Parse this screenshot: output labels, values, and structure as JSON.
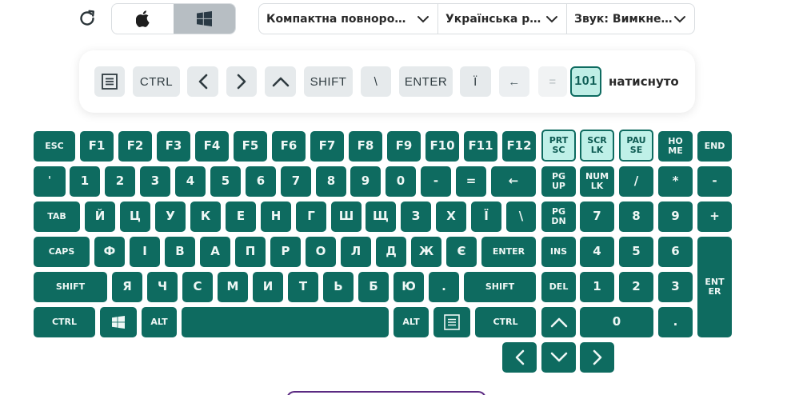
{
  "toolbar": {
    "os_options": [
      "apple-logo",
      "windows-logo"
    ],
    "os_selected": "windows",
    "dropdowns": [
      {
        "label": "Компактна повноро…"
      },
      {
        "label": "Українська р…"
      },
      {
        "label": "Звук: Вимкне…"
      }
    ]
  },
  "history": {
    "keys": [
      "menu-icon",
      "CTRL",
      "arrow-left-icon",
      "arrow-right-icon",
      "arrow-up-icon",
      "SHIFT",
      "\\",
      "ENTER",
      "Ї",
      "←",
      "=",
      "101"
    ],
    "count": "101",
    "status": "натиснуто"
  },
  "keyboard": {
    "rows": {
      "function": [
        "ESC",
        "F1",
        "F2",
        "F3",
        "F4",
        "F5",
        "F6",
        "F7",
        "F8",
        "F9",
        "F10",
        "F11",
        "F12",
        "PRT\nSC",
        "SCR\nLK",
        "PAU\nSE",
        "HO\nME",
        "END"
      ],
      "number": [
        "'",
        "1",
        "2",
        "3",
        "4",
        "5",
        "6",
        "7",
        "8",
        "9",
        "0",
        "-",
        "=",
        "←",
        "PG\nUP",
        "NUM\nLK",
        "/",
        "*",
        "-"
      ],
      "top": [
        "TAB",
        "Й",
        "Ц",
        "У",
        "К",
        "Е",
        "Н",
        "Г",
        "Ш",
        "Щ",
        "З",
        "Х",
        "Ї",
        "\\",
        "PG\nDN",
        "7",
        "8",
        "9",
        "+"
      ],
      "home": [
        "CAPS",
        "Ф",
        "І",
        "В",
        "А",
        "П",
        "Р",
        "О",
        "Л",
        "Д",
        "Ж",
        "Є",
        "ENTER",
        "INS",
        "4",
        "5",
        "6",
        "ENT\nER"
      ],
      "shift": [
        "SHIFT",
        "Я",
        "Ч",
        "С",
        "М",
        "И",
        "Т",
        "Ь",
        "Б",
        "Ю",
        ".",
        "SHIFT",
        "DEL",
        "1",
        "2",
        "3"
      ],
      "bottom": [
        "CTRL",
        "windows-icon",
        "ALT",
        "space",
        "ALT",
        "menu-icon",
        "CTRL",
        "arrow-up-icon",
        "0",
        "."
      ],
      "arrows": [
        "arrow-left-icon",
        "arrow-down-icon",
        "arrow-right-icon"
      ]
    },
    "highlighted": [
      "PRT SC",
      "SCR LK",
      "PAU SE"
    ],
    "colors": {
      "key": "#0e6b60",
      "key_text": "#eef7f5",
      "highlight": "#bff0e8"
    }
  }
}
